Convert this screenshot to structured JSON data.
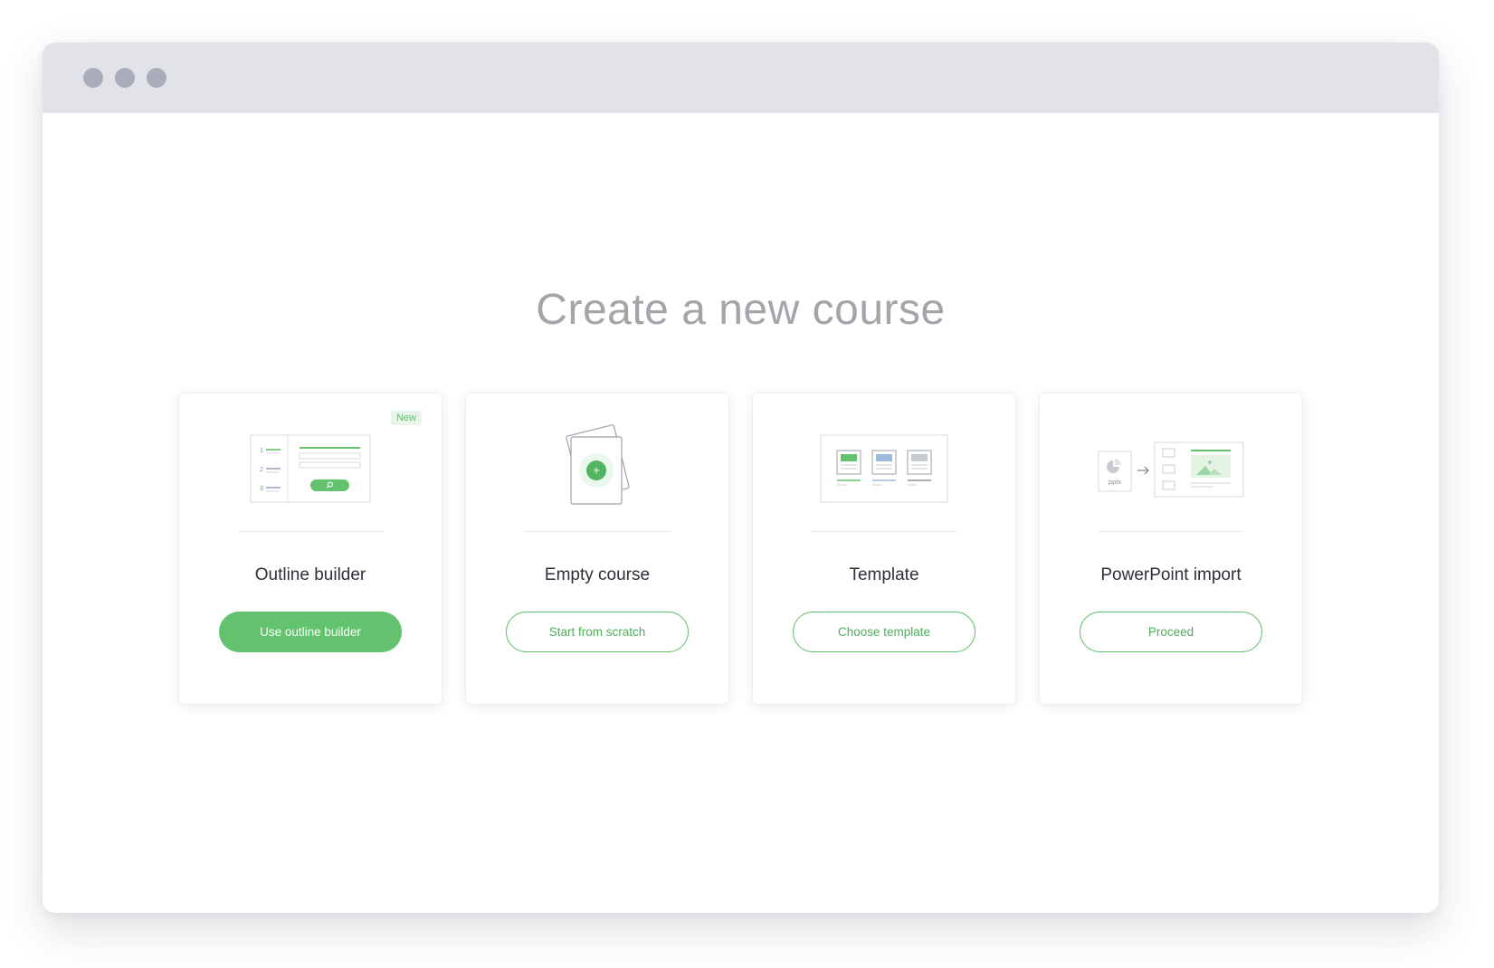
{
  "window": {
    "titlebar_dots": [
      "close",
      "minimize",
      "maximize"
    ]
  },
  "heading": "Create a new course",
  "colors": {
    "accent": "#62c26e",
    "titlebar": "#e1e3e8",
    "heading": "#a3a5aa"
  },
  "cards": [
    {
      "id": "outline-builder",
      "icon": "outline-builder-icon",
      "badge": "New",
      "title": "Outline builder",
      "button": "Use outline builder",
      "button_style": "primary",
      "numbers": [
        "1",
        "2",
        "3"
      ]
    },
    {
      "id": "empty-course",
      "icon": "empty-course-icon",
      "title": "Empty course",
      "button": "Start from scratch",
      "button_style": "outline",
      "plus": "+"
    },
    {
      "id": "template",
      "icon": "template-icon",
      "title": "Template",
      "button": "Choose template",
      "button_style": "outline"
    },
    {
      "id": "powerpoint-import",
      "icon": "powerpoint-import-icon",
      "title": "PowerPoint import",
      "button": "Proceed",
      "button_style": "outline",
      "file_label": "pptx"
    }
  ]
}
